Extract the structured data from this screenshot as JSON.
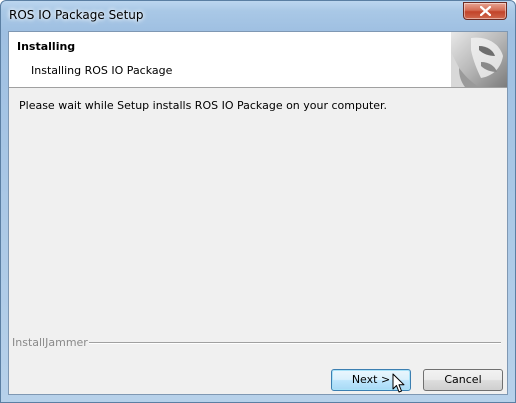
{
  "window": {
    "title": "ROS IO Package Setup"
  },
  "header": {
    "title": "Installing",
    "subtitle": "Installing ROS IO Package"
  },
  "body": {
    "message": "Please wait while Setup installs ROS IO Package on your computer."
  },
  "footer": {
    "brand": "InstallJammer"
  },
  "buttons": {
    "next_label": "Next >",
    "cancel_label": "Cancel"
  },
  "icons": {
    "close": "close-icon",
    "header_graphic": "installer-graphic-icon",
    "cursor": "mouse-pointer-icon"
  },
  "colors": {
    "titlebar": "#a9c8e6",
    "close_button": "#c2432a",
    "client_bg": "#f0f0f0",
    "default_button_border": "#3c7fb1"
  }
}
